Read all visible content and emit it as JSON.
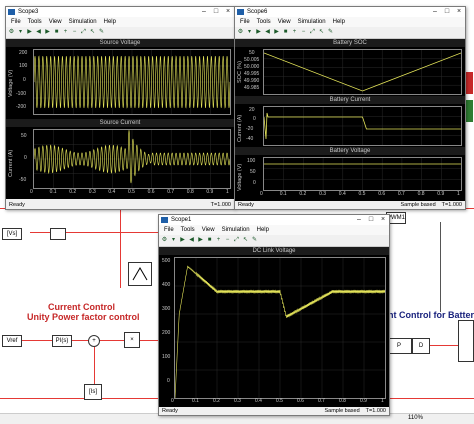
{
  "background": {
    "heading_current_control": "Current Control",
    "heading_unity_pf": "Unity Power factor control",
    "heading_battery_control": "ent Control for Batter",
    "block_labels": {
      "pwm": "PWM1",
      "pi": "PI(s)",
      "product": "×",
      "sum": "+",
      "vref": "Vref",
      "feedback": "[Is]",
      "tag_left": "[Vs]",
      "tag_right": "[Ib]",
      "battery_p": "P",
      "battery_d": "D"
    },
    "zoom": "110%"
  },
  "scope3": {
    "title": "Scope3",
    "menus": [
      "File",
      "Tools",
      "View",
      "Simulation",
      "Help"
    ],
    "status_left": "Ready",
    "status_right": "T=1.000",
    "axes": [
      {
        "title": "Source Voltage",
        "ylabel": "Voltage (V)",
        "yticks": [
          "200",
          "100",
          "0",
          "-100",
          "-200"
        ]
      },
      {
        "title": "Source Current",
        "ylabel": "Current (A)",
        "yticks": [
          "50",
          "0",
          "-50"
        ]
      }
    ],
    "xticks": [
      "0",
      "0.1",
      "0.2",
      "0.3",
      "0.4",
      "0.5",
      "0.6",
      "0.7",
      "0.8",
      "0.9",
      "1"
    ]
  },
  "scope6": {
    "title": "Scope6",
    "menus": [
      "File",
      "Tools",
      "View",
      "Simulation",
      "Help"
    ],
    "status_left": "Ready",
    "status_mid": "Sample based",
    "status_right": "T=1.000",
    "axes": [
      {
        "title": "Battery SOC",
        "ylabel": "SOC (%)",
        "yticks": [
          "50",
          "50.005",
          "50.000",
          "49.995",
          "49.990",
          "49.985"
        ]
      },
      {
        "title": "Battery Current",
        "ylabel": "Current (A)",
        "yticks": [
          "20",
          "0",
          "-20",
          "-40"
        ]
      },
      {
        "title": "Battery Voltage",
        "ylabel": "Voltage (V)",
        "yticks": [
          "100",
          "50",
          "0"
        ]
      }
    ],
    "xticks": [
      "0",
      "0.1",
      "0.2",
      "0.3",
      "0.4",
      "0.5",
      "0.6",
      "0.7",
      "0.8",
      "0.9",
      "1"
    ]
  },
  "scope1": {
    "title": "Scope1",
    "menus": [
      "File",
      "Tools",
      "View",
      "Simulation",
      "Help"
    ],
    "status_left": "Ready",
    "status_mid": "Sample based",
    "status_right": "T=1.000",
    "axes": [
      {
        "title": "DC Link Voltage",
        "ylabel": "",
        "yticks": [
          "500",
          "400",
          "300",
          "200",
          "100",
          "0"
        ]
      }
    ],
    "xticks": [
      "0",
      "0.1",
      "0.2",
      "0.3",
      "0.4",
      "0.5",
      "0.6",
      "0.7",
      "0.8",
      "0.9",
      "1"
    ]
  },
  "colors": {
    "trace": "#e6e65a",
    "plot_bg": "#000000",
    "wire": "#e53935",
    "heading_red": "#c62828",
    "heading_blue": "#1a237e"
  }
}
